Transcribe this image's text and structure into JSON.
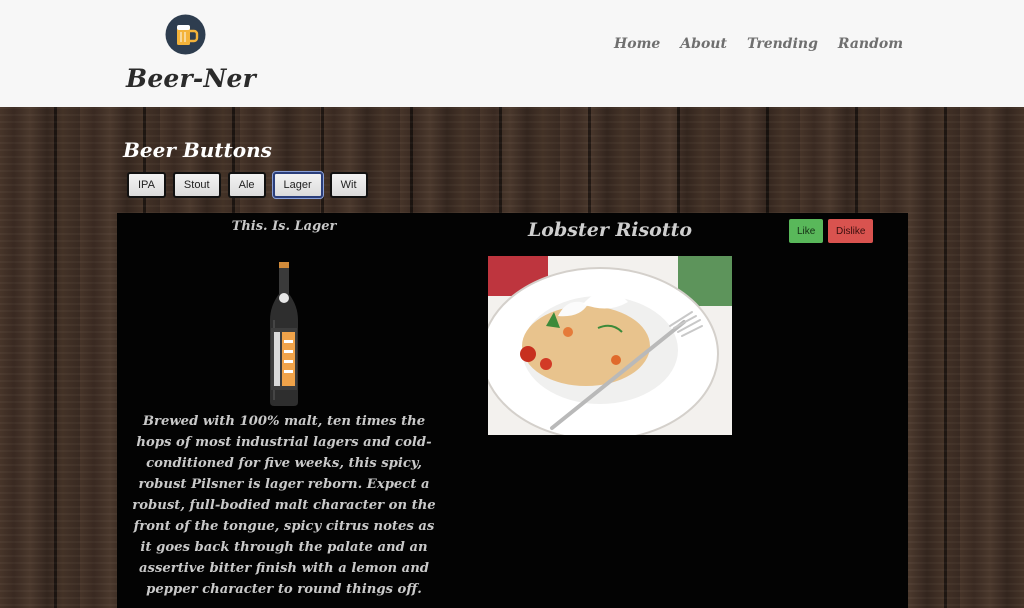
{
  "header": {
    "brand": "Beer-Ner",
    "nav": [
      "Home",
      "About",
      "Trending",
      "Random"
    ]
  },
  "beer_section": {
    "title": "Beer Buttons",
    "buttons": [
      "IPA",
      "Stout",
      "Ale",
      "Lager",
      "Wit"
    ],
    "selected": "Lager"
  },
  "beer": {
    "name": "This. Is. Lager",
    "bottle_label": "BREWDOG THIS IS LAGER",
    "description": "Brewed with 100% malt, ten times the hops of most industrial lagers and cold-conditioned for five weeks, this spicy, robust Pilsner is lager reborn. Expect a robust, full-bodied malt character on the front of the tongue, spicy citrus notes as it goes back through the palate and an assertive bitter finish with a lemon and pepper character to round things off."
  },
  "food": {
    "name": "Lobster Risotto",
    "like_label": "Like",
    "dislike_label": "Dislike"
  },
  "colors": {
    "header_bg": "#f7f7f7",
    "panel_bg": "#030303",
    "like": "#59b85a",
    "dislike": "#d9534f"
  }
}
